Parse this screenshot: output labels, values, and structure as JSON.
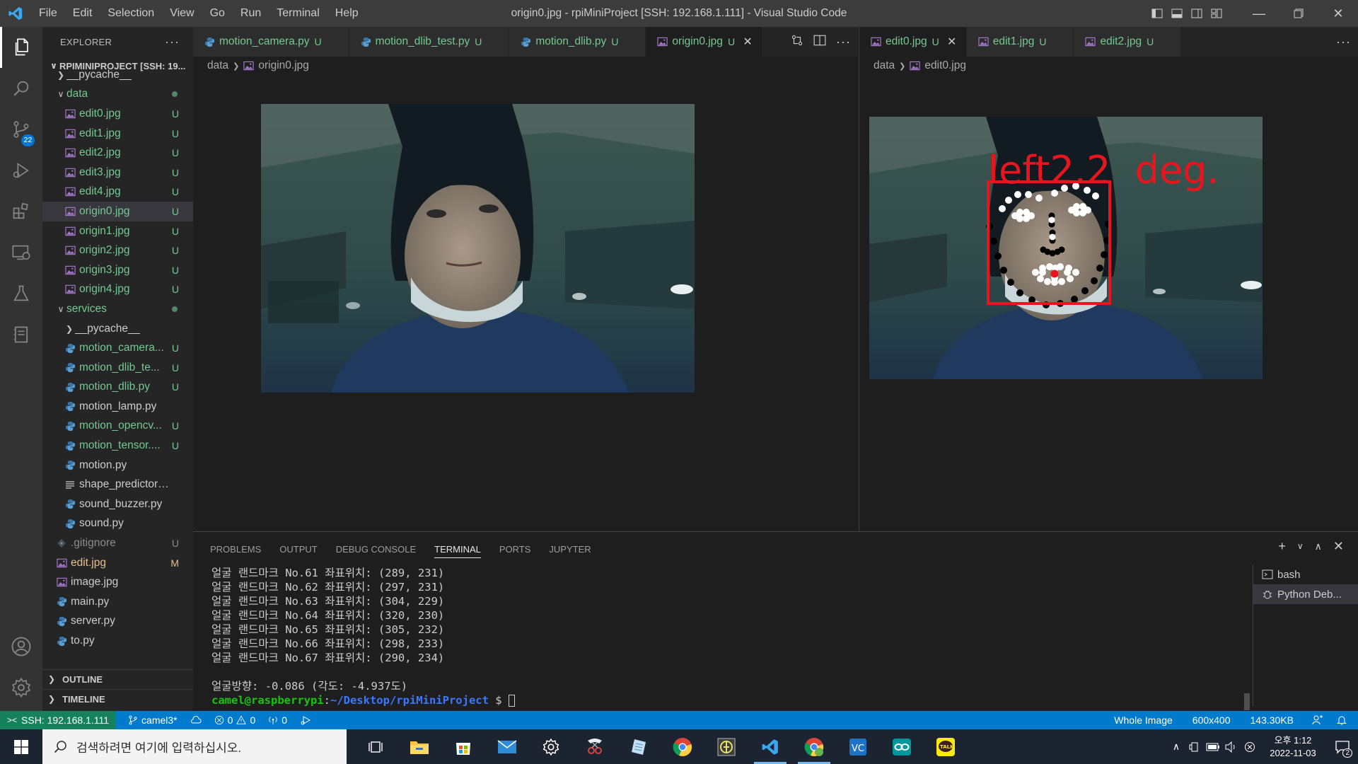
{
  "window": {
    "title": "origin0.jpg - rpiMiniProject [SSH: 192.168.1.111] - Visual Studio Code",
    "menu": [
      "File",
      "Edit",
      "Selection",
      "View",
      "Go",
      "Run",
      "Terminal",
      "Help"
    ]
  },
  "activity": {
    "source_control_badge": "22"
  },
  "sidebar": {
    "title": "EXPLORER",
    "more": "···",
    "project": "RPIMINIPROJECT [SSH: 19...",
    "items": [
      {
        "label": "__pycache__",
        "type": "folder-collapsed",
        "indent": 1,
        "status": "",
        "color": "plain",
        "partial": true
      },
      {
        "label": "data",
        "type": "folder-open",
        "indent": 1,
        "status": "dot",
        "color": "green"
      },
      {
        "label": "edit0.jpg",
        "type": "image",
        "indent": 2,
        "status": "U",
        "color": "green"
      },
      {
        "label": "edit1.jpg",
        "type": "image",
        "indent": 2,
        "status": "U",
        "color": "green"
      },
      {
        "label": "edit2.jpg",
        "type": "image",
        "indent": 2,
        "status": "U",
        "color": "green"
      },
      {
        "label": "edit3.jpg",
        "type": "image",
        "indent": 2,
        "status": "U",
        "color": "green"
      },
      {
        "label": "edit4.jpg",
        "type": "image",
        "indent": 2,
        "status": "U",
        "color": "green"
      },
      {
        "label": "origin0.jpg",
        "type": "image",
        "indent": 2,
        "status": "U",
        "color": "green",
        "selected": true
      },
      {
        "label": "origin1.jpg",
        "type": "image",
        "indent": 2,
        "status": "U",
        "color": "green"
      },
      {
        "label": "origin2.jpg",
        "type": "image",
        "indent": 2,
        "status": "U",
        "color": "green"
      },
      {
        "label": "origin3.jpg",
        "type": "image",
        "indent": 2,
        "status": "U",
        "color": "green"
      },
      {
        "label": "origin4.jpg",
        "type": "image",
        "indent": 2,
        "status": "U",
        "color": "green"
      },
      {
        "label": "services",
        "type": "folder-open",
        "indent": 1,
        "status": "dot",
        "color": "green"
      },
      {
        "label": "__pycache__",
        "type": "folder-collapsed",
        "indent": 2,
        "status": "",
        "color": "plain"
      },
      {
        "label": "motion_camera...",
        "type": "python",
        "indent": 2,
        "status": "U",
        "color": "green"
      },
      {
        "label": "motion_dlib_te...",
        "type": "python",
        "indent": 2,
        "status": "U",
        "color": "green"
      },
      {
        "label": "motion_dlib.py",
        "type": "python",
        "indent": 2,
        "status": "U",
        "color": "green"
      },
      {
        "label": "motion_lamp.py",
        "type": "python",
        "indent": 2,
        "status": "",
        "color": "plain"
      },
      {
        "label": "motion_opencv...",
        "type": "python",
        "indent": 2,
        "status": "U",
        "color": "green"
      },
      {
        "label": "motion_tensor....",
        "type": "python",
        "indent": 2,
        "status": "U",
        "color": "green"
      },
      {
        "label": "motion.py",
        "type": "python",
        "indent": 2,
        "status": "",
        "color": "plain"
      },
      {
        "label": "shape_predictor_68_...",
        "type": "text",
        "indent": 2,
        "status": "",
        "color": "plain"
      },
      {
        "label": "sound_buzzer.py",
        "type": "python",
        "indent": 2,
        "status": "",
        "color": "plain"
      },
      {
        "label": "sound.py",
        "type": "python",
        "indent": 2,
        "status": "",
        "color": "plain"
      },
      {
        "label": ".gitignore",
        "type": "git",
        "indent": 1,
        "status": "U",
        "color": "gitignore"
      },
      {
        "label": "edit.jpg",
        "type": "image",
        "indent": 1,
        "status": "M",
        "color": "mod"
      },
      {
        "label": "image.jpg",
        "type": "image",
        "indent": 1,
        "status": "",
        "color": "plain"
      },
      {
        "label": "main.py",
        "type": "python",
        "indent": 1,
        "status": "",
        "color": "plain"
      },
      {
        "label": "server.py",
        "type": "python",
        "indent": 1,
        "status": "",
        "color": "plain"
      },
      {
        "label": "to.py",
        "type": "python",
        "indent": 1,
        "status": "",
        "color": "plain"
      }
    ],
    "outline": "OUTLINE",
    "timeline": "TIMELINE"
  },
  "editor_left": {
    "tabs": [
      {
        "label": "motion_camera.py",
        "icon": "python",
        "status": "U"
      },
      {
        "label": "motion_dlib_test.py",
        "icon": "python",
        "status": "U"
      },
      {
        "label": "motion_dlib.py",
        "icon": "python",
        "status": "U"
      },
      {
        "label": "origin0.jpg",
        "icon": "image",
        "status": "U",
        "active": true
      }
    ],
    "breadcrumb": [
      "data",
      "origin0.jpg"
    ]
  },
  "editor_right": {
    "tabs": [
      {
        "label": "edit0.jpg",
        "icon": "image",
        "status": "U",
        "active": true
      },
      {
        "label": "edit1.jpg",
        "icon": "image",
        "status": "U"
      },
      {
        "label": "edit2.jpg",
        "icon": "image",
        "status": "U"
      }
    ],
    "breadcrumb": [
      "data",
      "edit0.jpg"
    ],
    "overlay_text": "left2.2  deg."
  },
  "panel": {
    "tabs": [
      "PROBLEMS",
      "OUTPUT",
      "DEBUG CONSOLE",
      "TERMINAL",
      "PORTS",
      "JUPYTER"
    ],
    "active_tab": "TERMINAL",
    "terminal_lines": [
      "얼굴 랜드마크 No.61 좌표위치: (289, 231)",
      "얼굴 랜드마크 No.62 좌표위치: (297, 231)",
      "얼굴 랜드마크 No.63 좌표위치: (304, 229)",
      "얼굴 랜드마크 No.64 좌표위치: (320, 230)",
      "얼굴 랜드마크 No.65 좌표위치: (305, 232)",
      "얼굴 랜드마크 No.66 좌표위치: (298, 233)",
      "얼굴 랜드마크 No.67 좌표위치: (290, 234)",
      "",
      "얼굴방향: -0.086 (각도: -4.937도)"
    ],
    "prompt_user": "camel@raspberrypi",
    "prompt_path": "~/Desktop/rpiMiniProject",
    "prompt_suffix": " $ ",
    "terminals": [
      "bash",
      "Python Deb..."
    ]
  },
  "statusbar": {
    "remote": "SSH: 192.168.1.111",
    "branch": "camel3*",
    "errors": "0",
    "warnings": "0",
    "ports": "0",
    "image_mode": "Whole Image",
    "dimensions": "600x400",
    "size": "143.30KB"
  },
  "taskbar": {
    "search_placeholder": "검색하려면 여기에 입력하십시오.",
    "time": "오후 1:12",
    "date": "2022-11-03",
    "notifications": "2"
  },
  "colors": {
    "accent": "#007acc",
    "remote": "#16825d",
    "untracked": "#73c991",
    "modified": "#e2c08d",
    "overlay_red": "#e8141e"
  }
}
